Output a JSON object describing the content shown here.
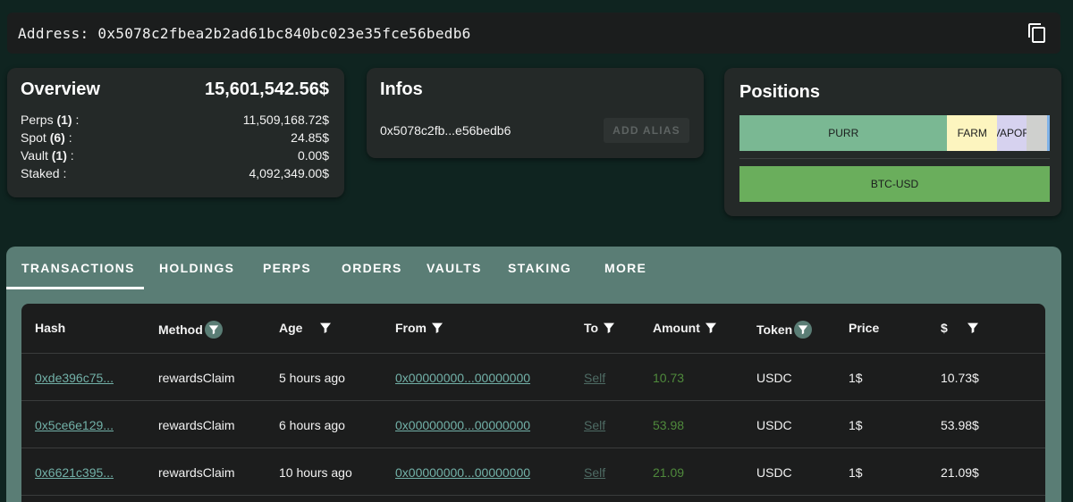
{
  "address_bar": {
    "label": "Address: 0x5078c2fbea2b2ad61bc840bc023e35fce56bedb6"
  },
  "overview": {
    "title": "Overview",
    "total": "15,601,542.56$",
    "rows": [
      {
        "label": "Perps",
        "count": "(1)",
        "suffix": " :",
        "value": "11,509,168.72$"
      },
      {
        "label": "Spot",
        "count": "(6)",
        "suffix": " :",
        "value": "24.85$"
      },
      {
        "label": "Vault",
        "count": "(1)",
        "suffix": " :",
        "value": "0.00$"
      },
      {
        "label": "Staked :",
        "count": "",
        "suffix": "",
        "value": "4,092,349.00$"
      }
    ]
  },
  "infos": {
    "title": "Infos",
    "address_short": "0x5078c2fb...e56bedb6",
    "add_alias": "ADD ALIAS"
  },
  "positions": {
    "title": "Positions",
    "spot_segments": [
      {
        "label": "PURR",
        "share": 0.67,
        "color": "#7ab893"
      },
      {
        "label": "FARM",
        "share": 0.16,
        "color": "#fdf5bf"
      },
      {
        "label": "VAPOR",
        "share": 0.095,
        "color": "#d6d2ef"
      },
      {
        "label": "",
        "share": 0.065,
        "color": "#cfd0ce"
      },
      {
        "label": "",
        "share": 0.01,
        "color": "#7fb2e8"
      }
    ],
    "perp_label": "BTC-USD"
  },
  "tabs": [
    "TRANSACTIONS",
    "HOLDINGS",
    "PERPS",
    "ORDERS",
    "VAULTS",
    "STAKING",
    "MORE"
  ],
  "table": {
    "headers": [
      "Hash",
      "Method",
      "Age",
      "From",
      "To",
      "Amount",
      "Token",
      "Price",
      "$"
    ],
    "rows": [
      {
        "hash": "0xde396c75...",
        "method": "rewardsClaim",
        "age": "5 hours ago",
        "from": "0x00000000...00000000",
        "to": "Self",
        "amount": "10.73",
        "token": "USDC",
        "price": "1$",
        "usd": "10.73$"
      },
      {
        "hash": "0x5ce6e129...",
        "method": "rewardsClaim",
        "age": "6 hours ago",
        "from": "0x00000000...00000000",
        "to": "Self",
        "amount": "53.98",
        "token": "USDC",
        "price": "1$",
        "usd": "53.98$"
      },
      {
        "hash": "0x6621c395...",
        "method": "rewardsClaim",
        "age": "10 hours ago",
        "from": "0x00000000...00000000",
        "to": "Self",
        "amount": "21.09",
        "token": "USDC",
        "price": "1$",
        "usd": "21.09$"
      }
    ]
  }
}
